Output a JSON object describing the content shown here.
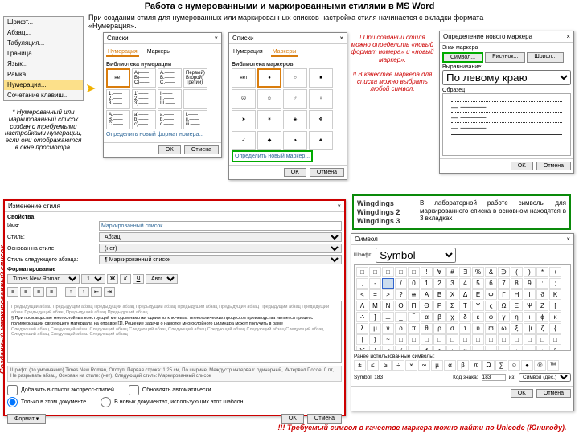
{
  "title": "Работа с нумерованными и маркированными стилями в MS Word",
  "intro": "При создании стиля для нумерованных или маркированных списков настройка стиля начинается с вкладки формата «Нумерация».",
  "menu": {
    "items": [
      "Шрифт...",
      "Абзац...",
      "Табуляция...",
      "Граница...",
      "Язык...",
      "Рамка...",
      "Нумерация...",
      "Сочетание клавиш..."
    ]
  },
  "note_left": "* Нумерованный или маркированный список создан с требуемыми настройками нумерации, если они отображаются в окне просмотра.",
  "dlg_lists": {
    "title": "Списки",
    "close": "×",
    "tab_num": "Нумерация",
    "tab_mark": "Маркеры",
    "lib_num": "Библиотека нумерации",
    "lib_mark": "Библиотека маркеров",
    "none": "нет",
    "num_rows": [
      [
        "1.",
        "2.",
        "3."
      ],
      [
        "1)",
        "2)",
        "3)"
      ],
      [
        "I.",
        "II.",
        "III."
      ],
      [
        "A.",
        "B.",
        "C."
      ],
      [
        "a)",
        "b)",
        "c)"
      ],
      [
        "a.",
        "b.",
        "c."
      ],
      [
        "i.",
        "ii.",
        "iii."
      ],
      [
        "A",
        "B",
        "C"
      ],
      [
        "Первый)",
        "Второй)",
        "Третий)"
      ]
    ],
    "mark_cells": [
      "нет",
      "●",
      "○",
      "■",
      "☹",
      "☺",
      "♂",
      "♀",
      "➤",
      "✶",
      "◈",
      "❖",
      "✓",
      "◆",
      "❧",
      "♣"
    ],
    "link_new_num": "Определить новый формат номера...",
    "link_new_mark": "Определить новый маркер...",
    "ok": "OK",
    "cancel": "Отмена"
  },
  "dlg_marker": {
    "title": "Определение нового маркера",
    "close": "×",
    "sign_label": "Знак маркера",
    "btn_symbol": "Символ...",
    "btn_pic": "Рисунок...",
    "btn_font": "Шрифт...",
    "align_label": "Выравнивание:",
    "align_value": "По левому краю",
    "preview_label": "Образец",
    "ok": "OK",
    "cancel": "Отмена"
  },
  "callout_red": "! При создании стиля можно определить «новый формат номера» и «новый маркер».\n\n!! В качестве маркера для списка  можно выбрать любой символ.",
  "wingdings": {
    "fonts": [
      "Wingdings",
      "Wingdings 2",
      "Wingdings 3"
    ],
    "text": "В лабораторной работе символы для маркированного списка в основном находятся в 3 вкладках"
  },
  "dlg_style": {
    "title": "Изменение стиля",
    "close": "×",
    "props": "Свойства",
    "name_label": "Имя:",
    "name_value": "Маркированный список",
    "type_label": "Стиль:",
    "type_value": "Абзац",
    "based_label": "Основан на стиле:",
    "based_value": "(нет)",
    "next_label": "Стиль следующего абзаца:",
    "next_value": "¶ Маркированный список",
    "format": "Форматирование",
    "font": "Times New Roman",
    "size": "10",
    "auto": "Авто",
    "preview_gray": "Предыдущий абзац Предыдущий абзац Предыдущий абзац Предыдущий абзац Предыдущий абзац Предыдущий абзац Предыдущий абзац Предыдущий абзац Предыдущий абзац Предыдущий абзац Предыдущий абзац",
    "preview_dark": "§    При производстве многослойных конструкций методом намотки одним из ключевых технологических процессов производства является процесс полимеризации связующего материала на оправке [1]. Решение задачи о намотке многослойного цилиндра может получить в раме",
    "preview_gray2": "Следующий абзац Следующий абзац Следующий абзац Следующий абзац Следующий абзац Следующий абзац Следующий абзац Следующий абзац Следующий абзац Следующий абзац Следующий абзац",
    "desc": "Шрифт: (по умолчанию) Times New Roman, Отступ: Первая строка: 1,25 см, По ширине, Междустр.интервал: одинарный, Интервал После: 0 пт, Не разрывать абзац, Основан на стиле: (нет), Следующий стиль: Маркированный список",
    "chk_add": "Добавить в список экспресс-стилей",
    "chk_auto": "Обновлять автоматически",
    "radio_doc": "Только в этом документе",
    "radio_tpl": "В новых документах, использующих этот шаблон",
    "btn_format": "Формат ▾",
    "ok": "OK",
    "cancel": "Отмена"
  },
  "side_label": "Созданный маркированный список",
  "dlg_symbol": {
    "title": "Символ",
    "close": "×",
    "font_label": "Шрифт:",
    "font_value": "Symbol",
    "grid": [
      "□",
      "□",
      "□",
      "□",
      "□",
      "!",
      "∀",
      "#",
      "∃",
      "%",
      "&",
      "∋",
      "(",
      ")",
      "*",
      "+",
      ",",
      "-",
      ".",
      "/",
      "0",
      "1",
      "2",
      "3",
      "4",
      "5",
      "6",
      "7",
      "8",
      "9",
      ":",
      ";",
      "<",
      "=",
      ">",
      "?",
      "≅",
      "Α",
      "Β",
      "Χ",
      "Δ",
      "Ε",
      "Φ",
      "Γ",
      "Η",
      "Ι",
      "ϑ",
      "Κ",
      "Λ",
      "Μ",
      "Ν",
      "Ο",
      "Π",
      "Θ",
      "Ρ",
      "Σ",
      "Τ",
      "Υ",
      "ς",
      "Ω",
      "Ξ",
      "Ψ",
      "Ζ",
      "[",
      "∴",
      "]",
      "⊥",
      "_",
      "‾",
      "α",
      "β",
      "χ",
      "δ",
      "ε",
      "φ",
      "γ",
      "η",
      "ι",
      "ϕ",
      "κ",
      "λ",
      "μ",
      "ν",
      "ο",
      "π",
      "θ",
      "ρ",
      "σ",
      "τ",
      "υ",
      "ϖ",
      "ω",
      "ξ",
      "ψ",
      "ζ",
      "{",
      "|",
      "}",
      "~",
      "□",
      "□",
      "□",
      "□",
      "□",
      "□",
      "□",
      "□",
      "□",
      "□",
      "□",
      "□",
      "□",
      "ϒ",
      "′",
      "≤",
      "⁄",
      "∞",
      "ƒ",
      "♣",
      "♦",
      "♥",
      "♠",
      "↔",
      "←",
      "↑",
      "→",
      "↓",
      "°"
    ],
    "sel_index": 18,
    "recent_label": "Ранее использованные символы:",
    "recent": [
      "±",
      "≤",
      "≥",
      "÷",
      "×",
      "∞",
      "µ",
      "α",
      "β",
      "π",
      "Ω",
      "∑",
      "☺",
      "●",
      "®",
      "™"
    ],
    "name_label": "Symbol: 183",
    "code_label": "Код знака:",
    "code_value": "183",
    "from_label": "из:",
    "from_value": "Символ (дес.)",
    "ok": "OK",
    "cancel": "Отмена"
  },
  "final_note": "!!! Требуемый символ в качестве маркера можно найти по Unicode (Юникоду)."
}
